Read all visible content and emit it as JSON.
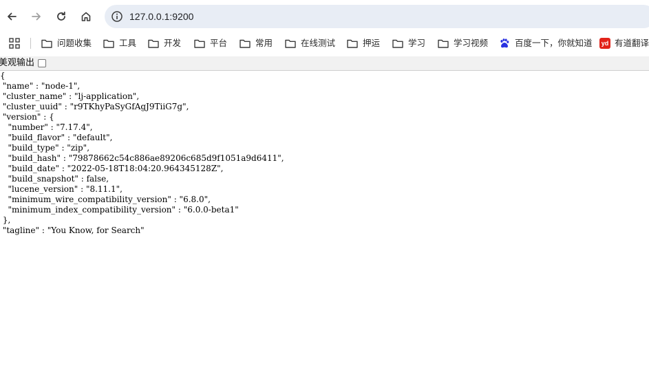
{
  "browser": {
    "url": "127.0.0.1:9200",
    "bookmarks": [
      {
        "label": "问题收集",
        "icon": "folder-icon"
      },
      {
        "label": "工具",
        "icon": "folder-icon"
      },
      {
        "label": "开发",
        "icon": "folder-icon"
      },
      {
        "label": "平台",
        "icon": "folder-icon"
      },
      {
        "label": "常用",
        "icon": "folder-icon"
      },
      {
        "label": "在线测试",
        "icon": "folder-icon"
      },
      {
        "label": "押运",
        "icon": "folder-icon"
      },
      {
        "label": "学习",
        "icon": "folder-icon"
      },
      {
        "label": "学习视频",
        "icon": "folder-icon"
      },
      {
        "label": "百度一下，你就知道",
        "icon": "baidu-paw-icon"
      },
      {
        "label": "有道翻译",
        "icon": "youdao-icon"
      }
    ],
    "youdao_badge": "yd"
  },
  "viewer": {
    "pretty_print_label": "美观输出",
    "pretty_print_checked": false
  },
  "json_lines": [
    "{",
    " \"name\" : \"node-1\",",
    " \"cluster_name\" : \"lj-application\",",
    " \"cluster_uuid\" : \"r9TKhyPaSyGfAgJ9TiiG7g\",",
    " \"version\" : {",
    "   \"number\" : \"7.17.4\",",
    "   \"build_flavor\" : \"default\",",
    "   \"build_type\" : \"zip\",",
    "   \"build_hash\" : \"79878662c54c886ae89206c685d9f1051a9d6411\",",
    "   \"build_date\" : \"2022-05-18T18:04:20.964345128Z\",",
    "   \"build_snapshot\" : false,",
    "   \"lucene_version\" : \"8.11.1\",",
    "   \"minimum_wire_compatibility_version\" : \"6.8.0\",",
    "   \"minimum_index_compatibility_version\" : \"6.0.0-beta1\"",
    " },",
    " \"tagline\" : \"You Know, for Search\""
  ]
}
